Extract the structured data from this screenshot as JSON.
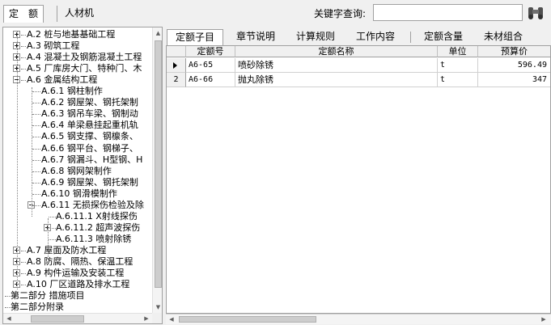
{
  "top": {
    "tabs": [
      "定　额",
      "人材机"
    ],
    "keyword_label": "关键字查询:",
    "keyword_value": ""
  },
  "tree": {
    "items": [
      {
        "label": "A.2 桩与地基基础工程",
        "expander": "plus"
      },
      {
        "label": "A.3 砌筑工程",
        "expander": "plus"
      },
      {
        "label": "A.4 混凝土及钢筋混凝土工程",
        "expander": "plus"
      },
      {
        "label": "A.5 厂库房大门、特种门、木",
        "expander": "plus"
      },
      {
        "label": "A.6 金属结构工程",
        "expander": "minus"
      },
      {
        "label": "A.6.1 钢柱制作",
        "expander": "none"
      },
      {
        "label": "A.6.2 钢屋架、钢托架制",
        "expander": "none"
      },
      {
        "label": "A.6.3 钢吊车梁、钢制动",
        "expander": "none"
      },
      {
        "label": "A.6.4 单梁悬挂起重机轨",
        "expander": "none"
      },
      {
        "label": "A.6.5 钢支撑、钢檩条、",
        "expander": "none"
      },
      {
        "label": "A.6.6 钢平台、钢梯子、",
        "expander": "none"
      },
      {
        "label": "A.6.7 钢漏斗、H型钢、H",
        "expander": "none"
      },
      {
        "label": "A.6.8 钢网架制作",
        "expander": "none"
      },
      {
        "label": "A.6.9 钢屋架、钢托架制",
        "expander": "none"
      },
      {
        "label": "A.6.10 钢滑模制作",
        "expander": "none"
      },
      {
        "label": "A.6.11 无损探伤检验及除",
        "expander": "minus"
      },
      {
        "label": "A.6.11.1 X射线探伤",
        "expander": "none"
      },
      {
        "label": "A.6.11.2 超声波探伤",
        "expander": "plus"
      },
      {
        "label": "A.6.11.3 喷射除锈",
        "expander": "none"
      },
      {
        "label": "A.7 屋面及防水工程",
        "expander": "plus"
      },
      {
        "label": "A.8 防腐、隔热、保温工程",
        "expander": "plus"
      },
      {
        "label": "A.9 构件运输及安装工程",
        "expander": "plus"
      },
      {
        "label": "A.10 厂区道路及排水工程",
        "expander": "plus"
      },
      {
        "label": "第二部分 措施项目",
        "expander": "none"
      },
      {
        "label": "第二部分附录",
        "expander": "none"
      }
    ]
  },
  "tabs": [
    {
      "label": "定额子目"
    },
    {
      "label": "章节说明"
    },
    {
      "label": "计算规则"
    },
    {
      "label": "工作内容"
    },
    {
      "label": "定额含量"
    },
    {
      "label": "未材组合"
    }
  ],
  "grid": {
    "headers": [
      "定额号",
      "定额名称",
      "单位",
      "预算价"
    ],
    "rows": [
      {
        "num": "1",
        "code": "A6-65",
        "name": "喷砂除锈",
        "unit": "t",
        "price": "596.49"
      },
      {
        "num": "2",
        "code": "A6-66",
        "name": "抛丸除锈",
        "unit": "t",
        "price": "347"
      }
    ]
  },
  "icons": {
    "search": "binoculars-icon",
    "scroll_up": "▲",
    "scroll_down": "▼",
    "scroll_left": "◀",
    "scroll_right": "▶"
  }
}
